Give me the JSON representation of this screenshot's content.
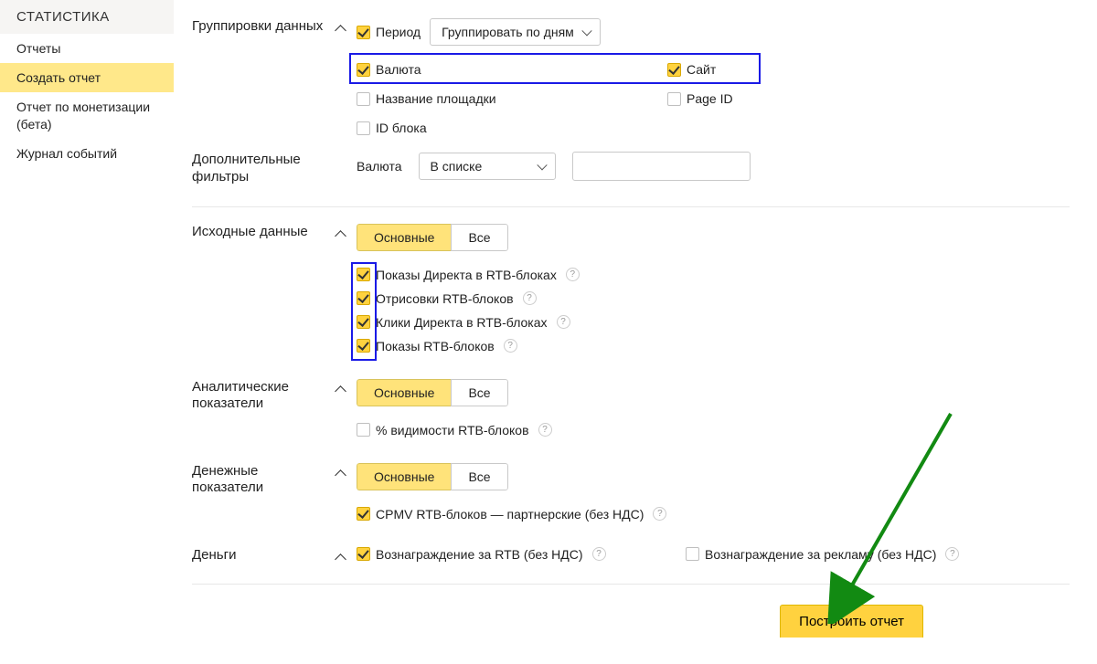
{
  "sidebar": {
    "title": "СТАТИСТИКА",
    "items": [
      {
        "label": "Отчеты"
      },
      {
        "label": "Создать отчет"
      },
      {
        "label": "Отчет по монетизации (бета)"
      },
      {
        "label": "Журнал событий"
      }
    ]
  },
  "groupings": {
    "title": "Группировки данных",
    "period_label": "Период",
    "group_by": "Группировать по дням",
    "options": {
      "currency": "Валюта",
      "site": "Сайт",
      "platform_name": "Название площадки",
      "page_id": "Page ID",
      "block_id": "ID блока"
    }
  },
  "filters": {
    "title": "Дополнительные фильтры",
    "field_label": "Валюта",
    "condition": "В списке"
  },
  "source_data": {
    "title": "Исходные данные",
    "tabs": {
      "main": "Основные",
      "all": "Все"
    },
    "items": [
      "Показы Директа в RTB-блоках",
      "Отрисовки RTB-блоков",
      "Клики Директа в RTB-блоках",
      "Показы RTB-блоков"
    ]
  },
  "analytics": {
    "title": "Аналитические показатели",
    "tabs": {
      "main": "Основные",
      "all": "Все"
    },
    "items": [
      "% видимости RTB-блоков"
    ]
  },
  "money_metrics": {
    "title": "Денежные показатели",
    "tabs": {
      "main": "Основные",
      "all": "Все"
    },
    "items": [
      "CPMV RTB-блоков — партнерские (без НДС)"
    ]
  },
  "money": {
    "title": "Деньги",
    "items": [
      "Вознаграждение за RTB (без НДС)",
      "Вознаграждение за рекламу (без НДС)"
    ]
  },
  "build_button": "Построить отчет"
}
